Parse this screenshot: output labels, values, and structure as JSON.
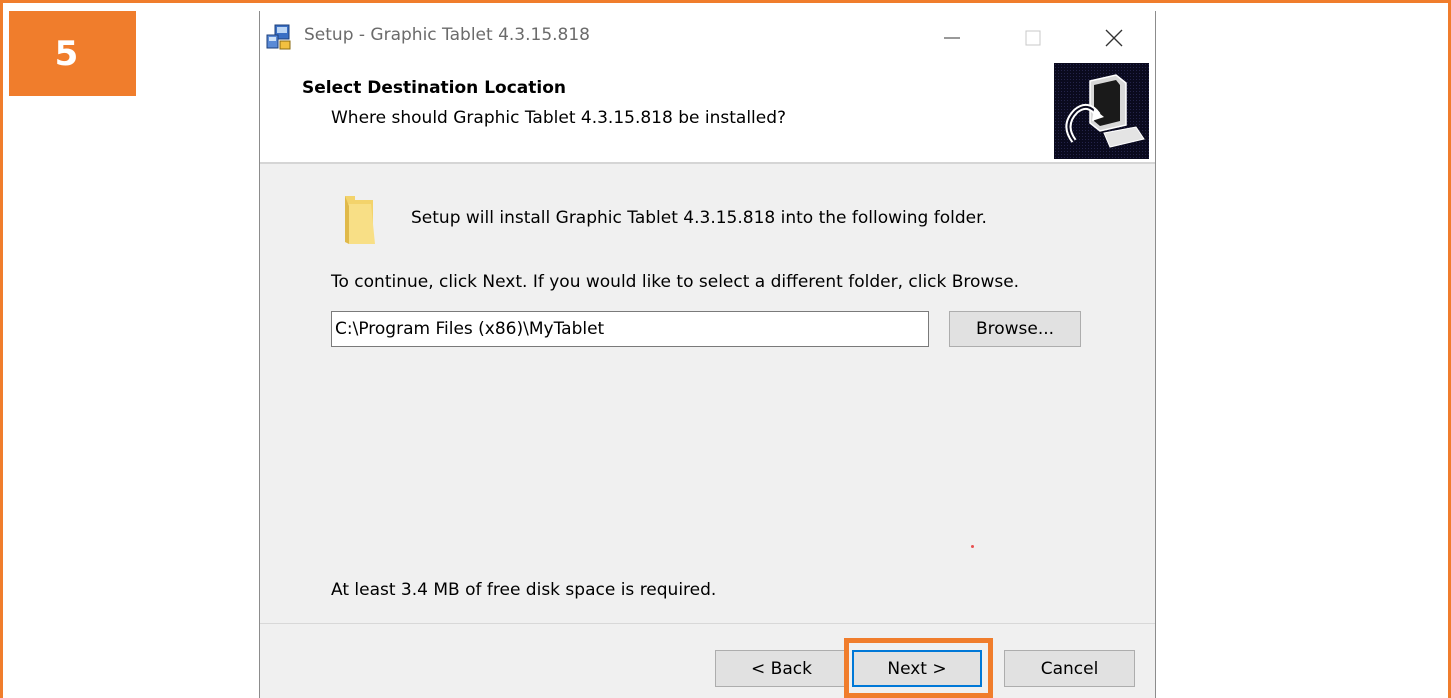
{
  "step": {
    "number": "5"
  },
  "window": {
    "title": "Setup - Graphic Tablet 4.3.15.818"
  },
  "header": {
    "title": "Select Destination Location",
    "subtitle": "Where should Graphic Tablet 4.3.15.818 be installed?"
  },
  "body": {
    "install_text": "Setup will install Graphic Tablet 4.3.15.818 into the following folder.",
    "continue_text": "To continue, click Next. If you would like to select a different folder, click Browse.",
    "path_value": "C:\\Program Files (x86)\\MyTablet",
    "browse_label": "Browse...",
    "space_text": "At least 3.4 MB of free disk space is required."
  },
  "footer": {
    "back_label": "< Back",
    "next_label": "Next >",
    "cancel_label": "Cancel"
  },
  "colors": {
    "accent_orange": "#f07d2c",
    "focus_blue": "#0078d7",
    "dialog_bg": "#f0f0f0"
  },
  "icons": [
    "setup-app-icon",
    "minimize-icon",
    "maximize-icon",
    "close-icon",
    "installer-computer-icon",
    "folder-icon"
  ]
}
